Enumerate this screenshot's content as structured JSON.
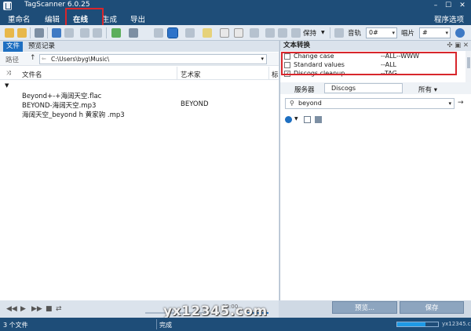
{
  "window": {
    "title": "TagScanner 6.0.25",
    "min": "–",
    "max": "☐",
    "close": "✕"
  },
  "menu": {
    "items": [
      "重命名",
      "编辑",
      "在线",
      "生成",
      "导出"
    ],
    "active_index": 2,
    "right": "程序选项"
  },
  "toolbar": {
    "save_label": "保持",
    "track_label": "音轨",
    "track_value": "0#",
    "disc_label": "唱片",
    "disc_value": "#"
  },
  "left": {
    "tabs": [
      "文件",
      "预览记录"
    ],
    "path_label": "路径",
    "path_value": "C:\\Users\\byg\\Music\\",
    "columns": [
      "文件名",
      "艺术家",
      "标"
    ],
    "files": [
      {
        "name": "Beyond+-+海阔天空.flac",
        "artist": ""
      },
      {
        "name": "BEYOND-海阔天空.mp3",
        "artist": "BEYOND"
      },
      {
        "name": "海阔天空_beyond h 黄家驹 .mp3",
        "artist": ""
      }
    ],
    "player": {
      "time": "00:00"
    }
  },
  "right": {
    "heading": "文本转换",
    "conversions": [
      {
        "name": "Change case",
        "rule": "--ALL--WWW",
        "checked": false
      },
      {
        "name": "Standard values",
        "rule": "--ALL",
        "checked": false
      },
      {
        "name": "Discogs cleanup",
        "rule": "--TAG",
        "checked": true
      }
    ],
    "server_label": "服务器",
    "server_value": "Discogs",
    "scope_value": "所有",
    "search_value": "beyond",
    "preview_button": "预览...",
    "save_button": "保存"
  },
  "status": {
    "count": "3 个文件",
    "state": "完成",
    "progress": 0.7
  },
  "watermark": {
    "main": "yx12345.com",
    "small": "yx12345.com"
  },
  "colors": {
    "titlebar": "#1e4d78",
    "accent": "#1e6fc1",
    "highlight": "#d8262c"
  }
}
